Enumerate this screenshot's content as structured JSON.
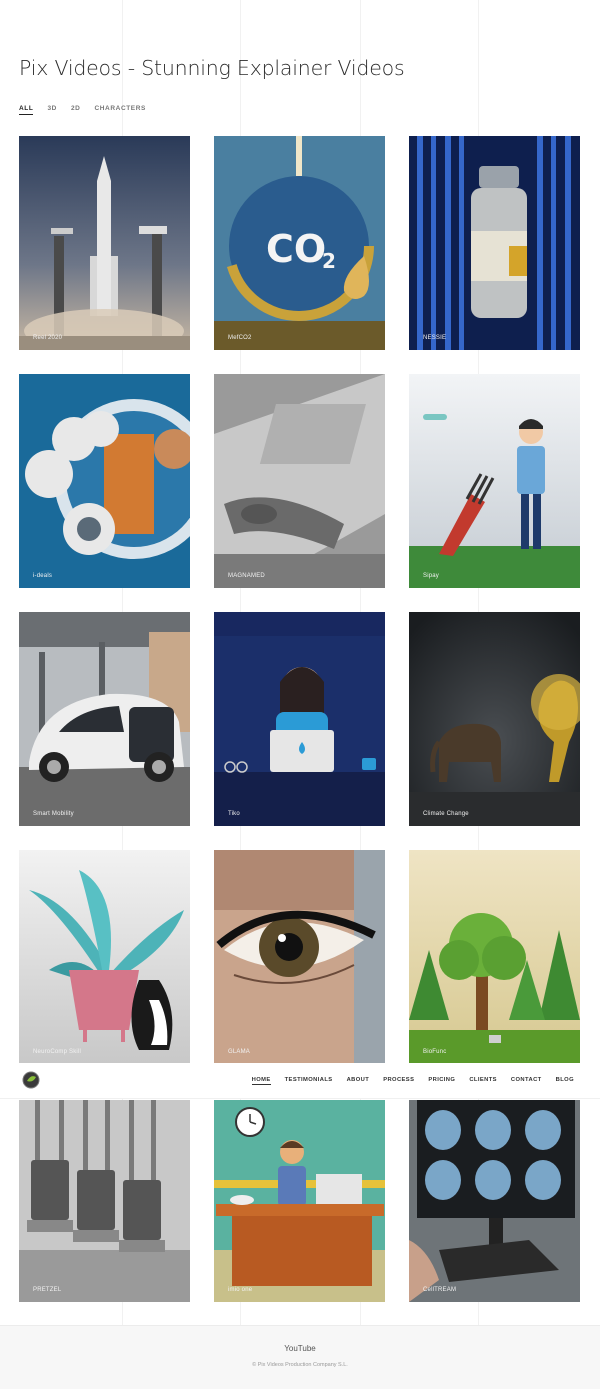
{
  "page": {
    "title": "Pix Videos - Stunning Explainer Videos"
  },
  "filters": [
    "ALL",
    "3D",
    "2D",
    "CHARACTERS"
  ],
  "portfolio": [
    {
      "label": "Reel 2020",
      "art": "rocket"
    },
    {
      "label": "MefCO2",
      "art": "co2"
    },
    {
      "label": "NESSIE",
      "art": "vial"
    },
    {
      "label": "i-deals",
      "art": "ideals"
    },
    {
      "label": "MAGNAMED",
      "art": "capsule"
    },
    {
      "label": "Sipay",
      "art": "golf"
    },
    {
      "label": "Smart Mobility",
      "art": "car"
    },
    {
      "label": "Tiko",
      "art": "laptop"
    },
    {
      "label": "Climate Change",
      "art": "elephant"
    },
    {
      "label": "NeuroComp Skill",
      "art": "plant"
    },
    {
      "label": "GLAMA",
      "art": "eye"
    },
    {
      "label": "BioFunc",
      "art": "forest"
    },
    {
      "label": "PRETZEL",
      "art": "machines"
    },
    {
      "label": "imio one",
      "art": "office"
    },
    {
      "label": "CellTREAM",
      "art": "brain"
    }
  ],
  "nav": {
    "items": [
      "HOME",
      "TESTIMONIALS",
      "ABOUT",
      "PROCESS",
      "PRICING",
      "CLIENTS",
      "CONTACT",
      "BLOG"
    ],
    "active": "HOME"
  },
  "footer": {
    "link": "YouTube",
    "copyright": "© Pix Videos Production Company S.L."
  }
}
